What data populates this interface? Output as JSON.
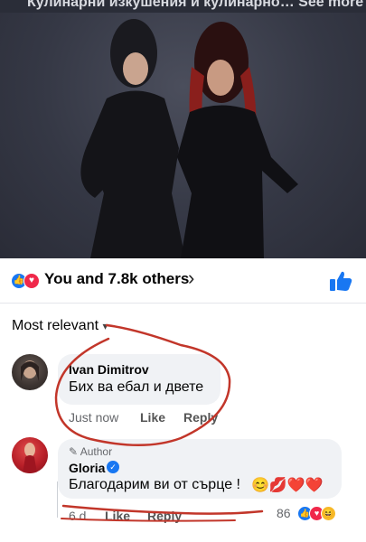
{
  "post": {
    "header_text": "Кулинарни изкушения и кулинарно… See more",
    "reaction_summary": "You and 7.8k others",
    "reaction_icons": [
      "like-icon",
      "love-icon"
    ]
  },
  "comments": {
    "sort_label": "Most relevant",
    "items": [
      {
        "author": "Ivan Dimitrov",
        "text": "Бих ва ебал и двете",
        "actions": [
          "Just now",
          "Like",
          "Reply"
        ]
      },
      {
        "author_tag": "Author",
        "author": "Gloria",
        "text": "Благодарим ви от сърце !",
        "emojis": [
          "😊",
          "💋",
          "❤️",
          "❤️"
        ],
        "actions": [
          "6 d",
          "Like",
          "Reply"
        ],
        "reaction_count": "86"
      }
    ]
  },
  "colors": {
    "facebook_blue": "#1877f2",
    "love_red": "#f0284a",
    "scribble_red": "#c2362a",
    "bubble_bg": "#f0f2f5"
  }
}
